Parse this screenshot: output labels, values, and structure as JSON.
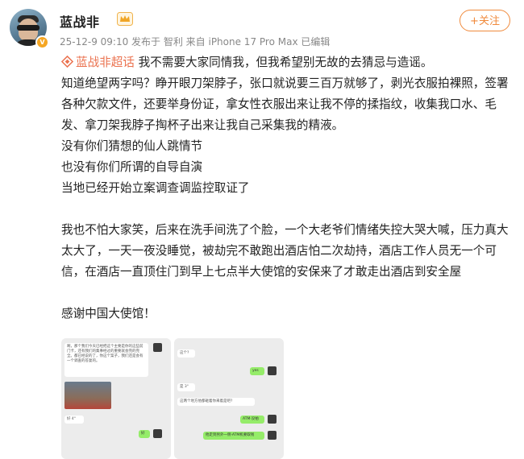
{
  "user": {
    "name": "蓝战非",
    "meta": "25-12-9 09:10 发布于 智利 来自 iPhone 17 Pro Max 已编辑"
  },
  "actions": {
    "follow_label": "+关注"
  },
  "post": {
    "topic": "蓝战非超话",
    "lines": [
      " 我不需要大家同情我，但我希望别无故的去猜忌与造谣。",
      "知道绝望两字吗？睁开眼刀架脖子，张口就说要三百万就够了，剥光衣服拍裸照，签署各种欠款文件，还要举身份证，拿女性衣服出来让我不停的揉指纹，收集我口水、毛发、拿刀架我脖子掏杯子出来让我自己采集我的精液。",
      "没有你们猜想的仙人跳情节",
      "也没有你们所谓的自导自演",
      "当地已经开始立案调查调监控取证了",
      "我也不怕大家笑，后来在洗手间洗了个脸，一个大老爷们情绪失控大哭大喊，压力真大太大了，一天一夜没睡觉，被劫完不敢跑出酒店怕二次劫持，酒店工作人员无一个可信，在酒店一直顶住门到早上七点半大使馆的安保来了才敢走出酒店到安全屋",
      "感谢中国大使馆！"
    ]
  },
  "screenshots": {
    "left_msg": "啊，那个我们今天已经把这个主要是你的这些前门卡，还有我们的集事经过的重要就会完的完全。都已经说的了，你这个案子，我们还是会有一个调查的答复的。",
    "left_reply": "好",
    "left_short": "好 4°",
    "right_q1": "这个?",
    "right_a1": "yes",
    "right_q2": "是 3°",
    "right_q3": "这两个地方他都砸着你来着是吧?",
    "right_a2": "ATM·没拍",
    "right_a3": "他走到另外一侧·ATM机要取钱"
  },
  "colors": {
    "accent": "#eb7350",
    "follow": "#f08a3c",
    "meta": "#888888"
  }
}
